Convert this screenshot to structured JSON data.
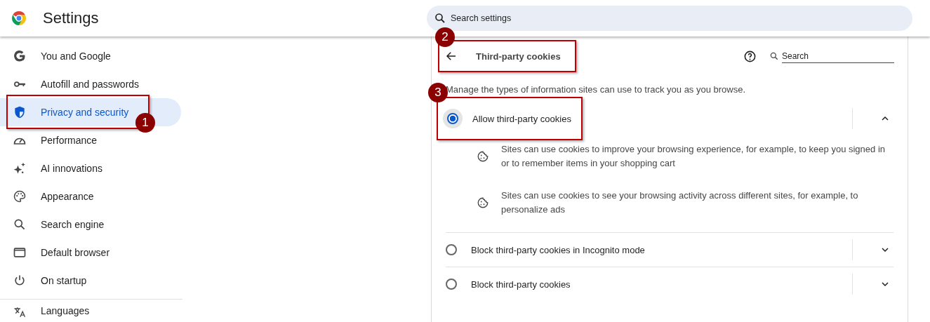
{
  "header": {
    "title": "Settings",
    "search": {
      "placeholder": "Search settings"
    }
  },
  "sidebar": {
    "items": [
      {
        "label": "You and Google",
        "kind": "google",
        "selected": false
      },
      {
        "label": "Autofill and passwords",
        "kind": "key",
        "selected": false
      },
      {
        "label": "Privacy and security",
        "kind": "shield",
        "selected": true,
        "annotation": "1"
      },
      {
        "label": "Performance",
        "kind": "gauge",
        "selected": false
      },
      {
        "label": "AI innovations",
        "kind": "sparkle",
        "selected": false
      },
      {
        "label": "Appearance",
        "kind": "palette",
        "selected": false
      },
      {
        "label": "Search engine",
        "kind": "search",
        "selected": false
      },
      {
        "label": "Default browser",
        "kind": "window",
        "selected": false
      },
      {
        "label": "On startup",
        "kind": "power",
        "selected": false
      }
    ],
    "lower_items": [
      {
        "label": "Languages",
        "kind": "translate",
        "selected": false
      }
    ]
  },
  "panel": {
    "title": "Third-party cookies",
    "annotation": "2",
    "search": {
      "placeholder": "Search"
    },
    "description": "Manage the types of information sites can use to track you as you browse.",
    "options": [
      {
        "label": "Allow third-party cookies",
        "selected": true,
        "expanded": true,
        "annotation": "3",
        "details": [
          "Sites can use cookies to improve your browsing experience, for example, to keep you signed in or to remember items in your shopping cart",
          "Sites can use cookies to see your browsing activity across different sites, for example, to personalize ads"
        ]
      },
      {
        "label": "Block third-party cookies in Incognito mode",
        "selected": false,
        "expanded": false
      },
      {
        "label": "Block third-party cookies",
        "selected": false,
        "expanded": false
      }
    ]
  }
}
